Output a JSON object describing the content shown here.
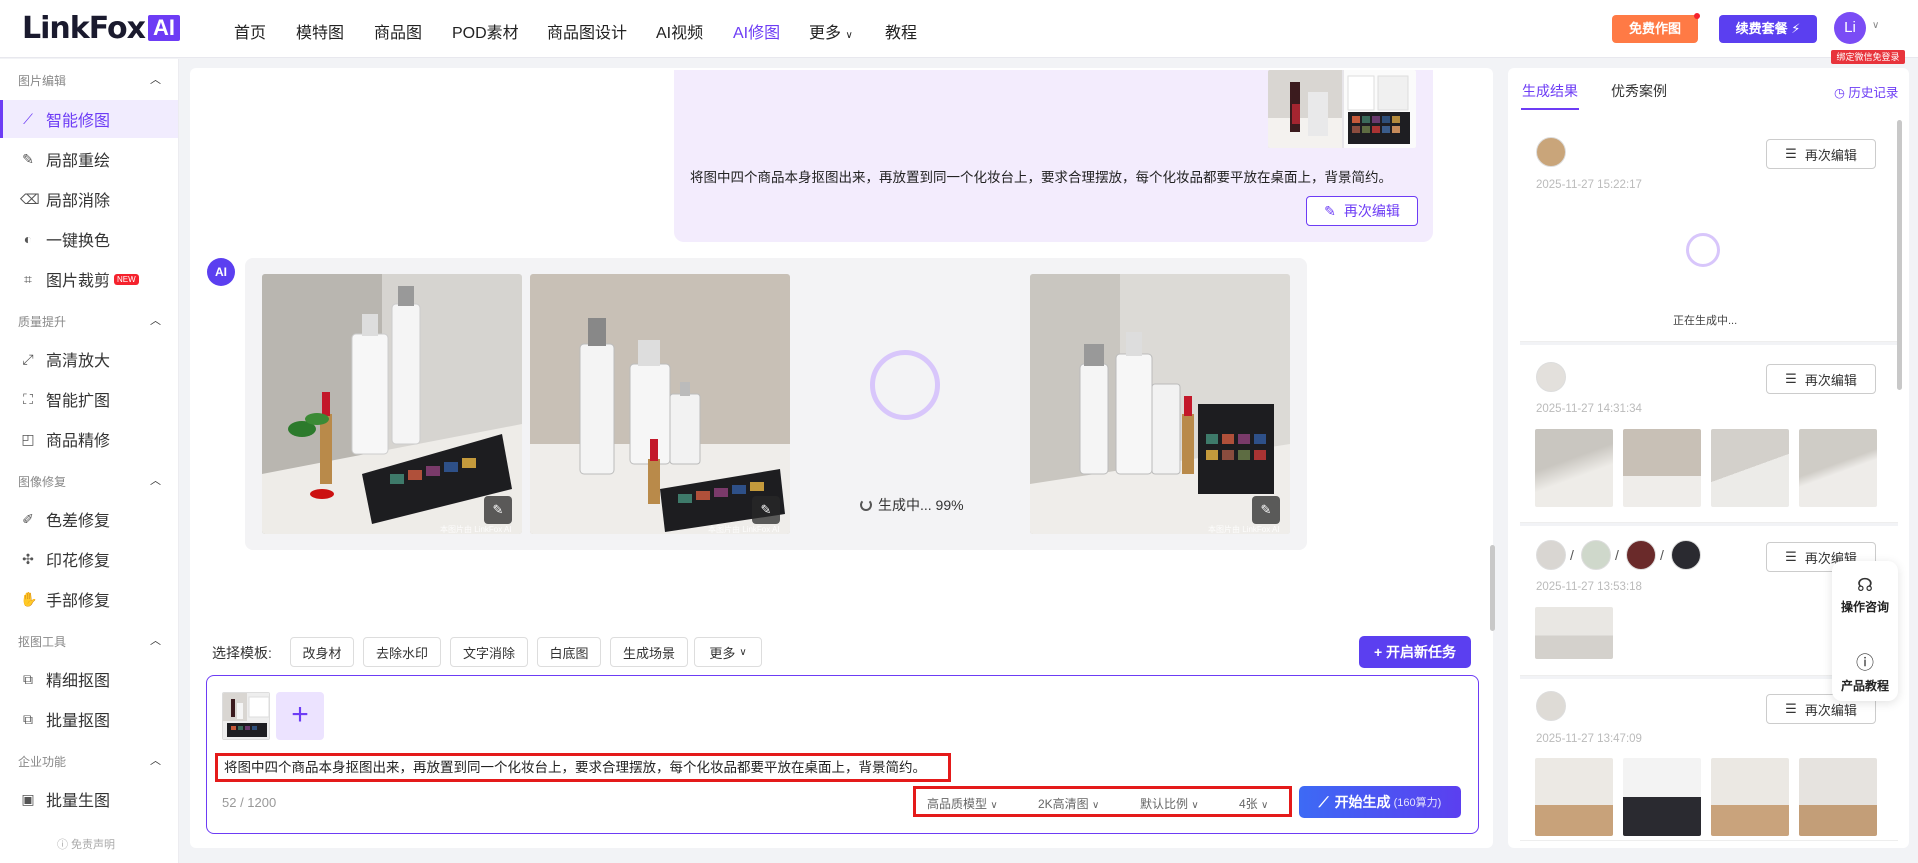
{
  "header": {
    "logo_text": "LinkFox",
    "logo_ai": "AI",
    "nav": [
      "首页",
      "模特图",
      "商品图",
      "POD素材",
      "商品图设计",
      "AI视频",
      "AI修图",
      "更多",
      "教程"
    ],
    "nav_more_chevron": "∨",
    "free_button": "免费作图",
    "renew_button": "续费套餐 ⚡",
    "avatar_text": "Li",
    "avatar_badge": "绑定微信免登录"
  },
  "sidebar": {
    "sections": [
      {
        "title": "图片编辑",
        "items": [
          "智能修图",
          "局部重绘",
          "局部消除",
          "一键换色",
          "图片裁剪"
        ]
      },
      {
        "title": "质量提升",
        "items": [
          "高清放大",
          "智能扩图",
          "商品精修"
        ]
      },
      {
        "title": "图像修复",
        "items": [
          "色差修复",
          "印花修复",
          "手部修复"
        ]
      },
      {
        "title": "抠图工具",
        "items": [
          "精细抠图",
          "批量抠图"
        ]
      },
      {
        "title": "企业功能",
        "items": [
          "批量生图"
        ]
      }
    ],
    "new_tag": "NEW",
    "disclaimer": "ⓘ 免责声明"
  },
  "chat": {
    "user_prompt": "将图中四个商品本身抠图出来，再放置到同一个化妆台上，要求合理摆放，每个化妆品都要平放在桌面上，背景简约。",
    "re_edit": "再次编辑",
    "ai_label": "AI",
    "watermark": "本图片由 LinkFox AI",
    "progress_text": "生成中... 99%"
  },
  "templates": {
    "label": "选择模板:",
    "items": [
      "改身材",
      "去除水印",
      "文字消除",
      "白底图",
      "生成场景",
      "更多"
    ],
    "new_task": "+ 开启新任务"
  },
  "input": {
    "prompt": "将图中四个商品本身抠图出来，再放置到同一个化妆台上，要求合理摆放，每个化妆品都要平放在桌面上，背景简约。",
    "counter": "52 / 1200",
    "options": [
      "高品质模型",
      "2K高清图",
      "默认比例",
      "4张"
    ],
    "start_button": "开始生成",
    "start_cost": "(160算力)"
  },
  "right_panel": {
    "tabs": [
      "生成结果",
      "优秀案例"
    ],
    "history": "历史记录",
    "cards": [
      {
        "time": "2025-11-27 15:22:17",
        "status": "正在生成中...",
        "edit": "再次编辑"
      },
      {
        "time": "2025-11-27 14:31:34",
        "edit": "再次编辑"
      },
      {
        "time": "2025-11-27 13:53:18",
        "edit": "再次编辑"
      },
      {
        "time": "2025-11-27 13:47:09",
        "edit": "再次编辑"
      }
    ],
    "help": [
      "操作咨询",
      "产品教程"
    ]
  },
  "colors": {
    "accent": "#6d3cf5",
    "highlight": "#e41a1a",
    "free": "#ff7a45"
  }
}
